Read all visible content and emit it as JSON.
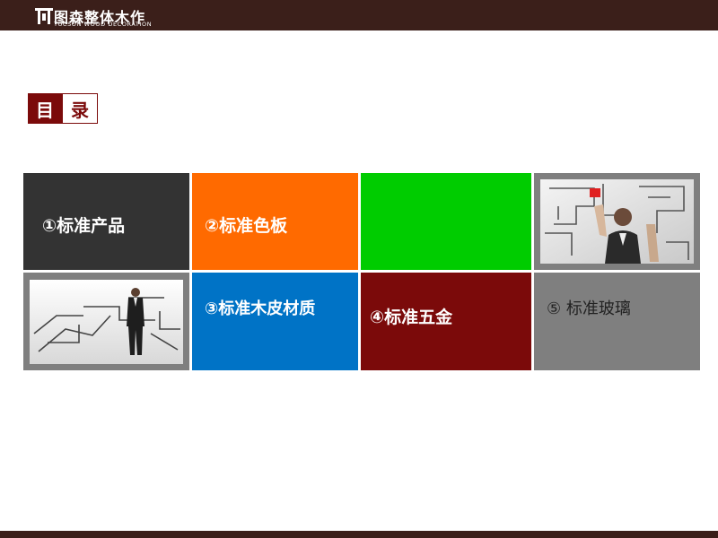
{
  "header": {
    "logo_cn": "图森整体木作",
    "logo_en": "TUCSON WOOD DECORATION"
  },
  "toc": {
    "left": "目",
    "right": "录"
  },
  "tiles": [
    {
      "label": "①标准产品",
      "color": "#333333"
    },
    {
      "label": "②标准色板",
      "color": "#ff6a00"
    },
    {
      "label": "",
      "color": "#00cc00"
    },
    {
      "label": "",
      "color": "#7f7f7f",
      "icon": "business-man-maze-photo-icon"
    },
    {
      "label": "",
      "color": "#7f7f7f",
      "icon": "business-man-standing-maze-photo-icon"
    },
    {
      "label": "③标准木皮材质",
      "color": "#0073c6"
    },
    {
      "label": "④标准五金",
      "color": "#7b0a0a"
    },
    {
      "label": "⑤ 标准玻璃",
      "color": "#7f7f7f"
    }
  ],
  "colors": {
    "bar": "#3b1f1a",
    "accent": "#7b0a0a"
  }
}
